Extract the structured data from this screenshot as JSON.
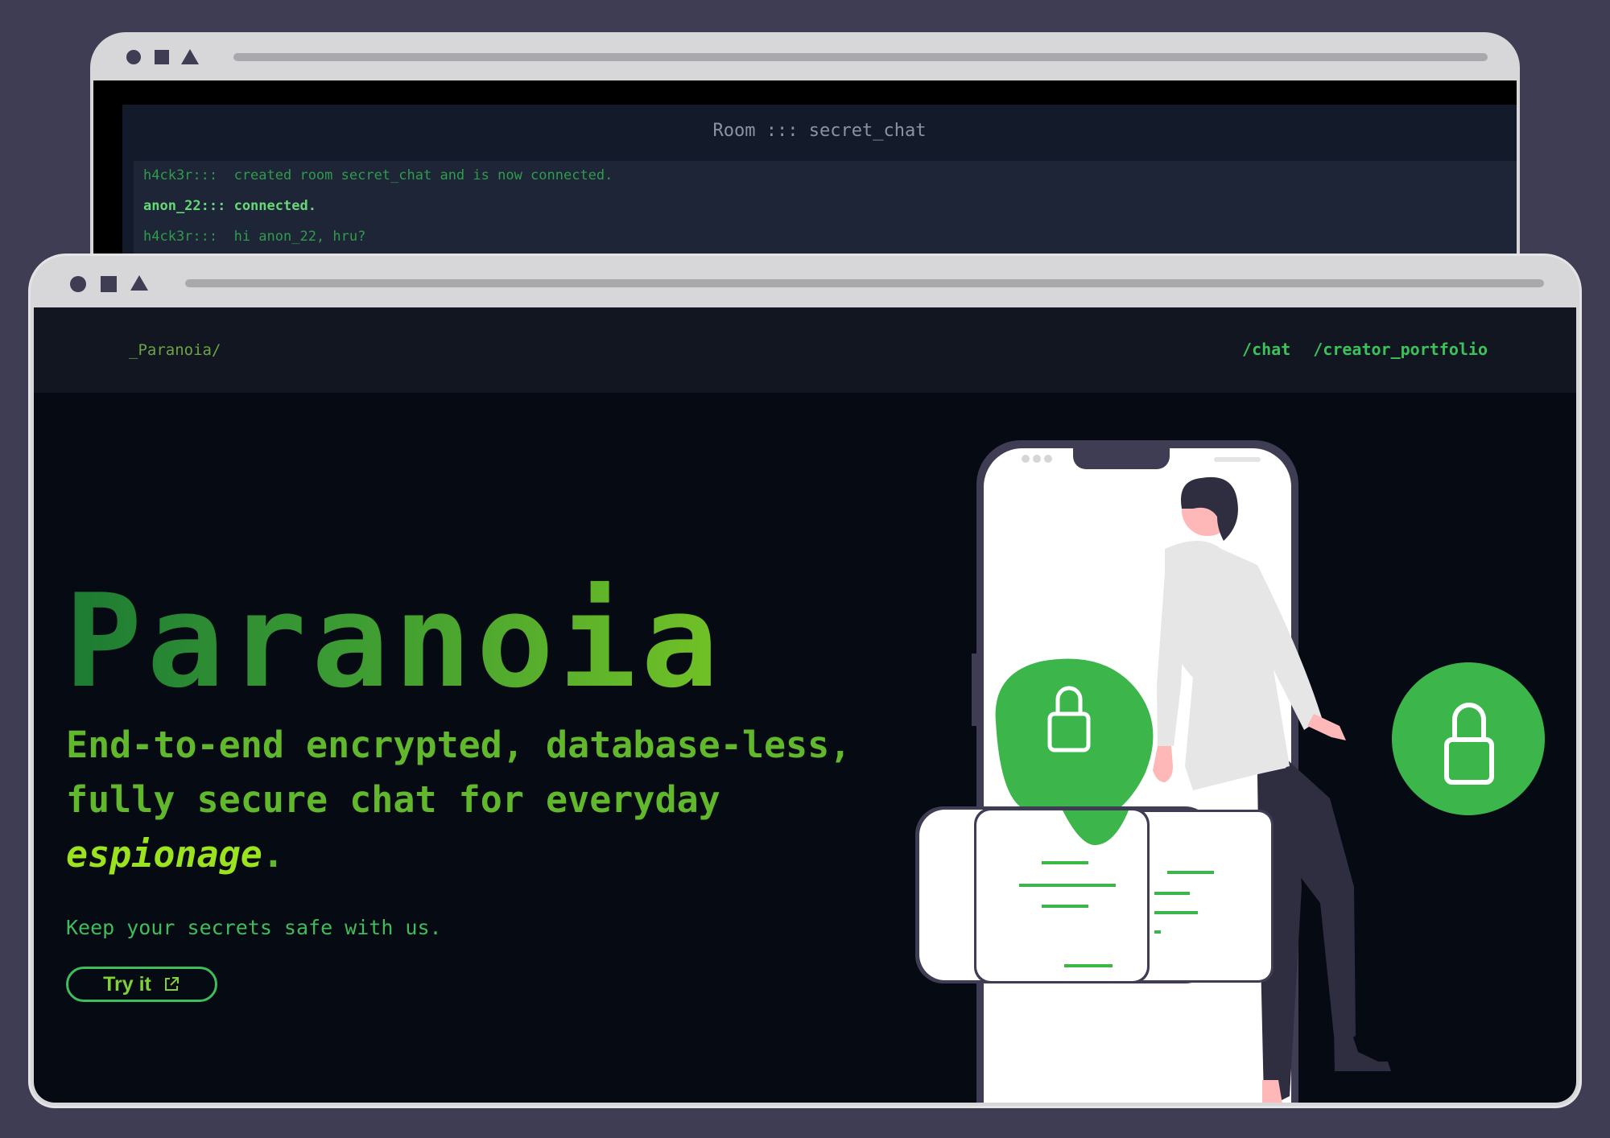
{
  "back_window": {
    "room_title": "Room ::: secret_chat",
    "messages": [
      "h4ck3r:::  created room secret_chat and is now connected.",
      "anon_22::: connected.",
      "h4ck3r:::  hi anon_22, hru?"
    ]
  },
  "front_window": {
    "brand": "_Paranoia/",
    "nav": {
      "chat": "/chat",
      "portfolio": "/creator_portfolio"
    },
    "hero": {
      "title": "Paranoia",
      "tagline_line1": "End-to-end encrypted, database-less,",
      "tagline_line2": "fully secure chat for everyday",
      "tagline_emphasis": "espionage",
      "tagline_end": ".",
      "subline": "Keep your secrets safe with us.",
      "cta_label": "Try it"
    }
  },
  "icons": [
    "window-circle-icon",
    "window-square-icon",
    "window-triangle-icon",
    "external-link-icon",
    "padlock-icon"
  ],
  "colors": {
    "background": "#3f3d53",
    "accent_green": "#3fbd5c",
    "lime": "#9be21f",
    "page_bg": "#060b13"
  }
}
